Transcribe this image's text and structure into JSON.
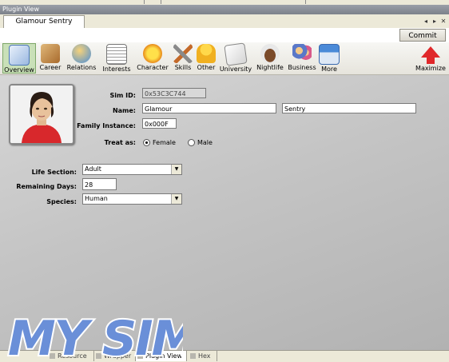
{
  "window": {
    "title": "Plugin View"
  },
  "document_tab": {
    "label": "Glamour Sentry",
    "controls": [
      "◂",
      "▸",
      "✕"
    ]
  },
  "commit_label": "Commit",
  "toolbar": {
    "items": [
      {
        "label": "Overview",
        "icon": "overview-icon",
        "active": true
      },
      {
        "label": "Career",
        "icon": "career-icon"
      },
      {
        "label": "Relations",
        "icon": "relations-icon"
      },
      {
        "label": "Interests",
        "icon": "interests-icon"
      },
      {
        "label": "Character",
        "icon": "character-icon"
      },
      {
        "label": "Skills",
        "icon": "skills-icon"
      },
      {
        "label": "Other",
        "icon": "other-icon"
      },
      {
        "label": "University",
        "icon": "university-icon"
      },
      {
        "label": "Nightlife",
        "icon": "nightlife-icon"
      },
      {
        "label": "Business",
        "icon": "business-icon"
      },
      {
        "label": "More",
        "icon": "more-icon"
      }
    ],
    "maximize_label": "Maximize"
  },
  "form": {
    "sim_id_label": "Sim ID:",
    "sim_id_value": "0x53C3C744",
    "name_label": "Name:",
    "first_name": "Glamour",
    "last_name": "Sentry",
    "family_instance_label": "Family Instance:",
    "family_instance_value": "0x000F",
    "treat_as_label": "Treat as:",
    "treat_as_options": [
      "Female",
      "Male"
    ],
    "treat_as_selected": "Female",
    "life_section_label": "Life Section:",
    "life_section_value": "Adult",
    "remaining_days_label": "Remaining Days:",
    "remaining_days_value": "28",
    "species_label": "Species:",
    "species_value": "Human"
  },
  "bottom_tabs": [
    {
      "label": "Resource",
      "active": false
    },
    {
      "label": "Wrapper",
      "active": false
    },
    {
      "label": "Plugin View",
      "active": true
    },
    {
      "label": "Hex",
      "active": false
    }
  ],
  "watermark": {
    "text": "MY SIMS"
  },
  "colors": {
    "active_tool_bg": "#c9e0b8",
    "main_bg": "#c4c4c4",
    "watermark_fill": "#6a8fd8"
  }
}
